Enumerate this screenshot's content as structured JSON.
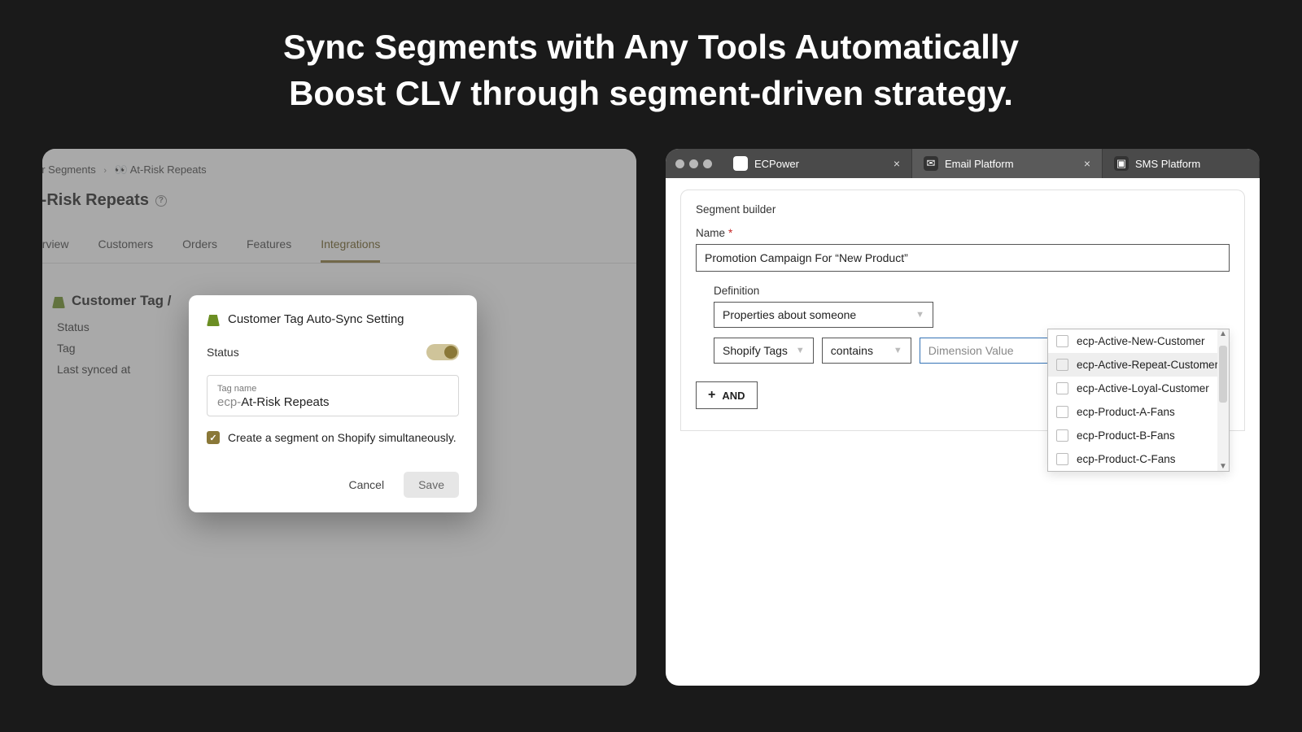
{
  "headline": {
    "line1": "Sync Segments with Any Tools Automatically",
    "line2": "Boost CLV through segment-driven strategy."
  },
  "left": {
    "breadcrumb": {
      "parent_partial": "er Segments",
      "current": "At-Risk Repeats"
    },
    "page_title_partial": "t-Risk Repeats",
    "tabs": {
      "overview_partial": "erview",
      "customers": "Customers",
      "orders": "Orders",
      "features": "Features",
      "integrations": "Integrations",
      "active": "Integrations"
    },
    "section_head_partial": "Customer Tag /",
    "status_rows": {
      "status": "Status",
      "tag": "Tag",
      "last_synced": "Last synced at"
    },
    "modal": {
      "title": "Customer Tag Auto-Sync Setting",
      "status_label": "Status",
      "tag_float_label": "Tag name",
      "tag_prefix": "ecp-",
      "tag_value": "At-Risk Repeats",
      "checkbox_label": "Create a segment on Shopify simultaneously.",
      "cancel": "Cancel",
      "save": "Save"
    }
  },
  "right": {
    "tabs": [
      {
        "name": "ECPower",
        "active": false,
        "closable": true
      },
      {
        "name": "Email Platform",
        "active": true,
        "closable": true
      },
      {
        "name": "SMS Platform",
        "active": false,
        "closable": false
      }
    ],
    "builder": {
      "title": "Segment builder",
      "name_label": "Name",
      "name_value": "Promotion Campaign For “New Product”",
      "definition_label": "Definition",
      "property_select": "Properties about someone",
      "field_select": "Shopify Tags",
      "op_select": "contains",
      "dim_placeholder": "Dimension Value",
      "and_label": "AND",
      "dropdown": [
        "ecp-Active-New-Customer",
        "ecp-Active-Repeat-Customer",
        "ecp-Active-Loyal-Customer",
        "ecp-Product-A-Fans",
        "ecp-Product-B-Fans",
        "ecp-Product-C-Fans"
      ],
      "dropdown_highlight_index": 1
    }
  }
}
